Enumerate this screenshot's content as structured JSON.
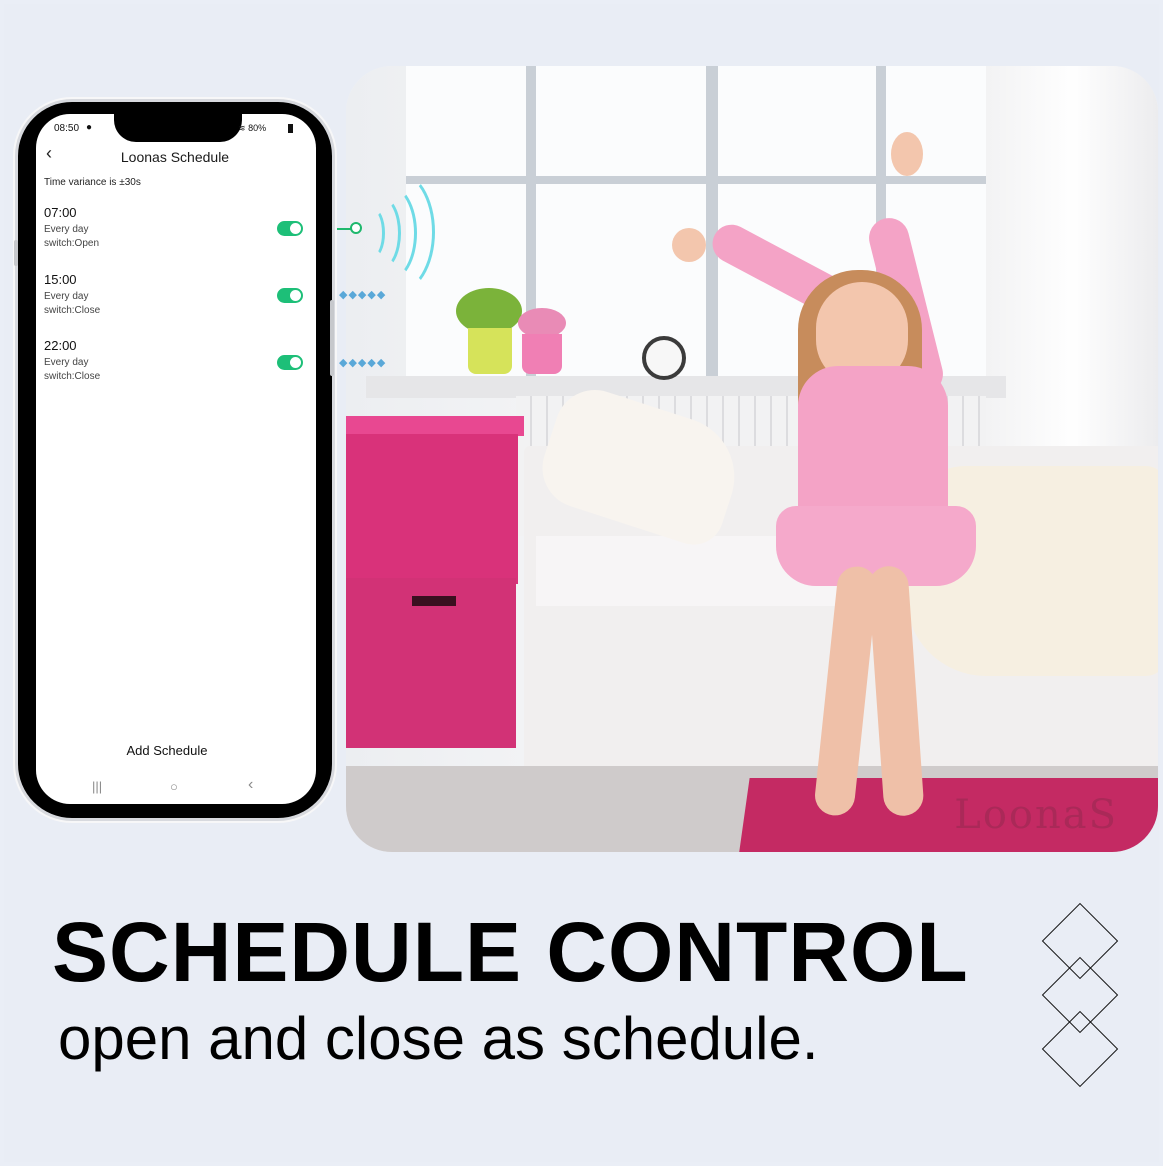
{
  "phone": {
    "status_time": "08:50",
    "status_right": "80%",
    "screen_title": "Loonas Schedule",
    "variance_text": "Time variance is ±30s",
    "schedules": [
      {
        "time": "07:00",
        "repeat": "Every day",
        "action": "switch:Open",
        "enabled": true
      },
      {
        "time": "15:00",
        "repeat": "Every day",
        "action": "switch:Close",
        "enabled": true
      },
      {
        "time": "22:00",
        "repeat": "Every day",
        "action": "switch:Close",
        "enabled": true
      }
    ],
    "add_button_label": "Add Schedule",
    "nav": {
      "recent": "|||",
      "home": "○",
      "back": "‹"
    }
  },
  "photo": {
    "watermark": "LoonaS"
  },
  "headline": {
    "title": "SCHEDULE CONTROL",
    "subtitle": "open and close as schedule."
  },
  "colors": {
    "toggle_on": "#1dbf78",
    "wave": "#6fdbe6",
    "background": "#eaeef6"
  },
  "icons": [
    "back-chevron-icon",
    "wechat-icon",
    "wifi-icon",
    "signal-icon",
    "battery-icon",
    "recent-apps-icon",
    "home-icon",
    "back-nav-icon",
    "diamond-decoration-icon"
  ]
}
